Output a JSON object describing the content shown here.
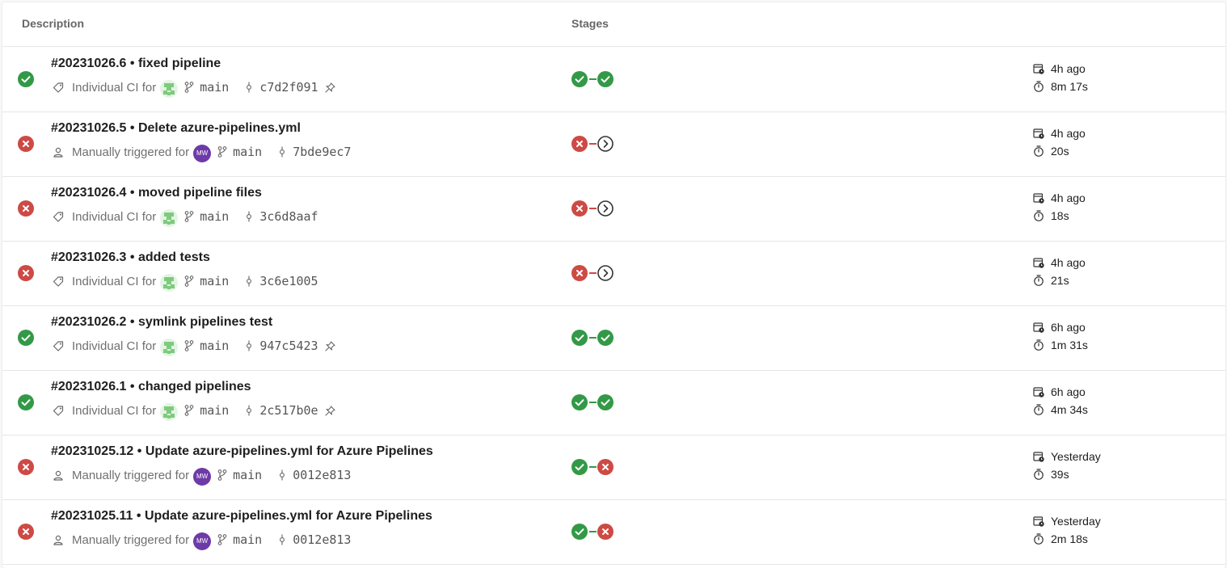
{
  "header": {
    "description": "Description",
    "stages": "Stages"
  },
  "colors": {
    "success": "#339947",
    "failure": "#cd4a45",
    "pending": "#333333",
    "avatar_mw": "#6e3aa8"
  },
  "runs": [
    {
      "number": "#20231026.6",
      "message": "fixed pipeline",
      "status": "success",
      "trigger": "Individual CI for",
      "trigger_icon": "tag-icon",
      "avatar": "identicon",
      "avatar_initials": "",
      "branch": "main",
      "commit": "c7d2f091",
      "pinned": true,
      "stages": [
        "success",
        "success"
      ],
      "started": "4h ago",
      "duration": "8m 17s"
    },
    {
      "number": "#20231026.5",
      "message": "Delete azure-pipelines.yml",
      "status": "failure",
      "trigger": "Manually triggered for",
      "trigger_icon": "person-icon",
      "avatar": "mw",
      "avatar_initials": "MW",
      "branch": "main",
      "commit": "7bde9ec7",
      "pinned": false,
      "stages": [
        "failure",
        "skipped"
      ],
      "started": "4h ago",
      "duration": "20s"
    },
    {
      "number": "#20231026.4",
      "message": "moved pipeline files",
      "status": "failure",
      "trigger": "Individual CI for",
      "trigger_icon": "tag-icon",
      "avatar": "identicon",
      "avatar_initials": "",
      "branch": "main",
      "commit": "3c6d8aaf",
      "pinned": false,
      "stages": [
        "failure",
        "skipped"
      ],
      "started": "4h ago",
      "duration": "18s"
    },
    {
      "number": "#20231026.3",
      "message": "added tests",
      "status": "failure",
      "trigger": "Individual CI for",
      "trigger_icon": "tag-icon",
      "avatar": "identicon",
      "avatar_initials": "",
      "branch": "main",
      "commit": "3c6e1005",
      "pinned": false,
      "stages": [
        "failure",
        "skipped"
      ],
      "started": "4h ago",
      "duration": "21s"
    },
    {
      "number": "#20231026.2",
      "message": "symlink pipelines test",
      "status": "success",
      "trigger": "Individual CI for",
      "trigger_icon": "tag-icon",
      "avatar": "identicon",
      "avatar_initials": "",
      "branch": "main",
      "commit": "947c5423",
      "pinned": true,
      "stages": [
        "success",
        "success"
      ],
      "started": "6h ago",
      "duration": "1m 31s"
    },
    {
      "number": "#20231026.1",
      "message": "changed pipelines",
      "status": "success",
      "trigger": "Individual CI for",
      "trigger_icon": "tag-icon",
      "avatar": "identicon",
      "avatar_initials": "",
      "branch": "main",
      "commit": "2c517b0e",
      "pinned": true,
      "stages": [
        "success",
        "success"
      ],
      "started": "6h ago",
      "duration": "4m 34s"
    },
    {
      "number": "#20231025.12",
      "message": "Update azure-pipelines.yml for Azure Pipelines",
      "status": "failure",
      "trigger": "Manually triggered for",
      "trigger_icon": "person-icon",
      "avatar": "mw",
      "avatar_initials": "MW",
      "branch": "main",
      "commit": "0012e813",
      "pinned": false,
      "stages": [
        "success",
        "failure"
      ],
      "started": "Yesterday",
      "duration": "39s"
    },
    {
      "number": "#20231025.11",
      "message": "Update azure-pipelines.yml for Azure Pipelines",
      "status": "failure",
      "trigger": "Manually triggered for",
      "trigger_icon": "person-icon",
      "avatar": "mw",
      "avatar_initials": "MW",
      "branch": "main",
      "commit": "0012e813",
      "pinned": false,
      "stages": [
        "success",
        "failure"
      ],
      "started": "Yesterday",
      "duration": "2m 18s"
    }
  ]
}
